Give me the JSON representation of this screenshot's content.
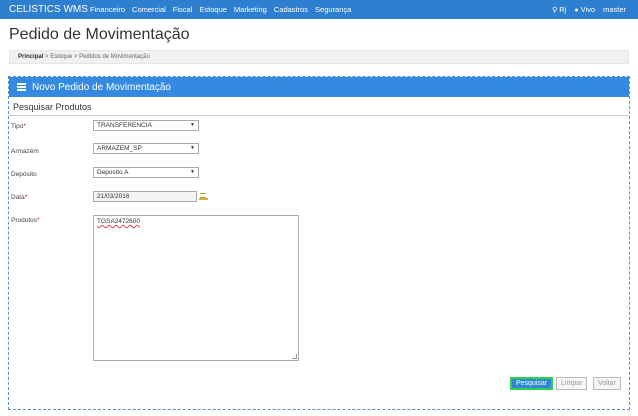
{
  "navbar": {
    "brand": "CELISTICS WMS",
    "menu": [
      "Financeiro",
      "Comercial",
      "Fiscal",
      "Estoque",
      "Marketing",
      "Cadastros",
      "Segurança"
    ],
    "location_icon": "map-marker-icon",
    "location": "Rj",
    "user_icon": "user-icon",
    "user": "Vivo",
    "account": "master"
  },
  "page": {
    "title": "Pedido de Movimentação"
  },
  "breadcrumb": {
    "items": [
      "Principal",
      "Estoque",
      "Pedidos de Movimentação"
    ],
    "separator": ">"
  },
  "panel": {
    "icon": "list-icon",
    "title": "Novo Pedido de Movimentação",
    "section": "Pesquisar Produtos"
  },
  "form": {
    "tipo": {
      "label": "Tipo",
      "required": "*",
      "value": "TRANSFERENCIA"
    },
    "armazem": {
      "label": "Armazém",
      "value": "ARMAZEM_SP"
    },
    "deposito": {
      "label": "Depósito",
      "value": "Deposito A"
    },
    "data": {
      "label": "Data",
      "required": "*",
      "value": "21/03/2016"
    },
    "produtos": {
      "label": "Produtos",
      "required": "*",
      "value": "TGSA2472600"
    }
  },
  "buttons": {
    "search": "Pesquisar",
    "clear": "Limpar",
    "back": "Voltar"
  },
  "colors": {
    "navbar": "#2f7fd1",
    "panel_header": "#338ae0",
    "primary_button": "#2d86d6",
    "focus_outline": "#2bd34a"
  }
}
